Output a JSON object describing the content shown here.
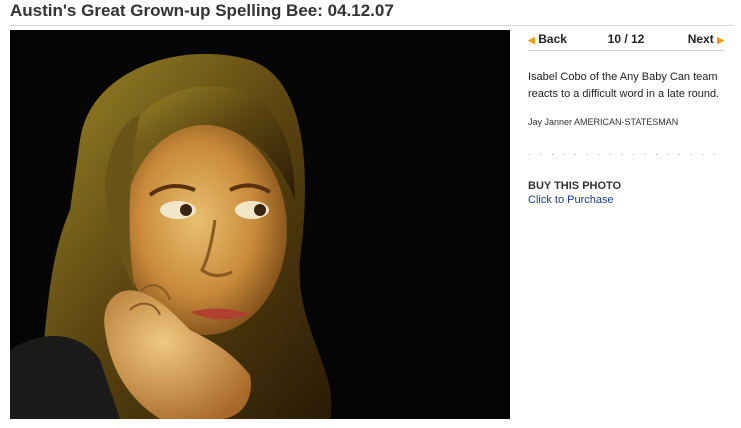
{
  "page": {
    "title": "Austin's Great Grown-up Spelling Bee: 04.12.07"
  },
  "gallery": {
    "back_label": "Back",
    "counter": "10 / 12",
    "next_label": "Next",
    "back_arrow": "◀",
    "next_arrow": "▶",
    "caption": "Isabel Cobo of the Any Baby Can team reacts to a difficult word in a late round.",
    "credit": "Jay Janner AMERICAN-STATESMAN",
    "separator": ". . . . . . . . . . . . . . . . . . . . . . . . . . . .",
    "buy_heading": "BUY THIS PHOTO",
    "buy_link": "Click to Purchase",
    "accent_color": "#f29a00",
    "link_color": "#1a3a8c"
  }
}
